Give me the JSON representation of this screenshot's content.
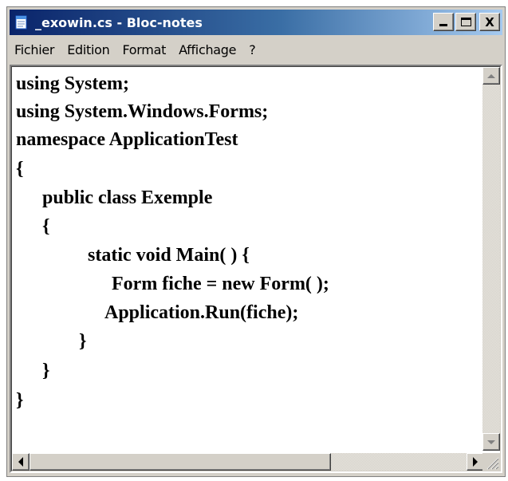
{
  "window": {
    "title": "_exowin.cs - Bloc-notes",
    "app_icon": "notepad-icon",
    "buttons": {
      "minimize_icon": "minimize-icon",
      "maximize_icon": "maximize-icon",
      "close_label": "X"
    }
  },
  "menu": {
    "items": [
      {
        "label": "Fichier"
      },
      {
        "label": "Edition"
      },
      {
        "label": "Format"
      },
      {
        "label": "Affichage"
      },
      {
        "label": "?"
      }
    ]
  },
  "editor": {
    "lines": [
      "using System;",
      "using System.Windows.Forms;",
      "namespace ApplicationTest",
      "{",
      "public class Exemple",
      "{",
      "static void Main( ) {",
      "Form fiche = new Form( );",
      "Application.Run(fiche);",
      "}",
      "}",
      "}"
    ]
  },
  "scrollbars": {
    "vertical_up_icon": "scroll-up-icon",
    "vertical_down_icon": "scroll-down-icon",
    "horizontal_left_icon": "scroll-left-icon",
    "horizontal_right_icon": "scroll-right-icon",
    "resize_grip_icon": "resize-grip-icon"
  }
}
